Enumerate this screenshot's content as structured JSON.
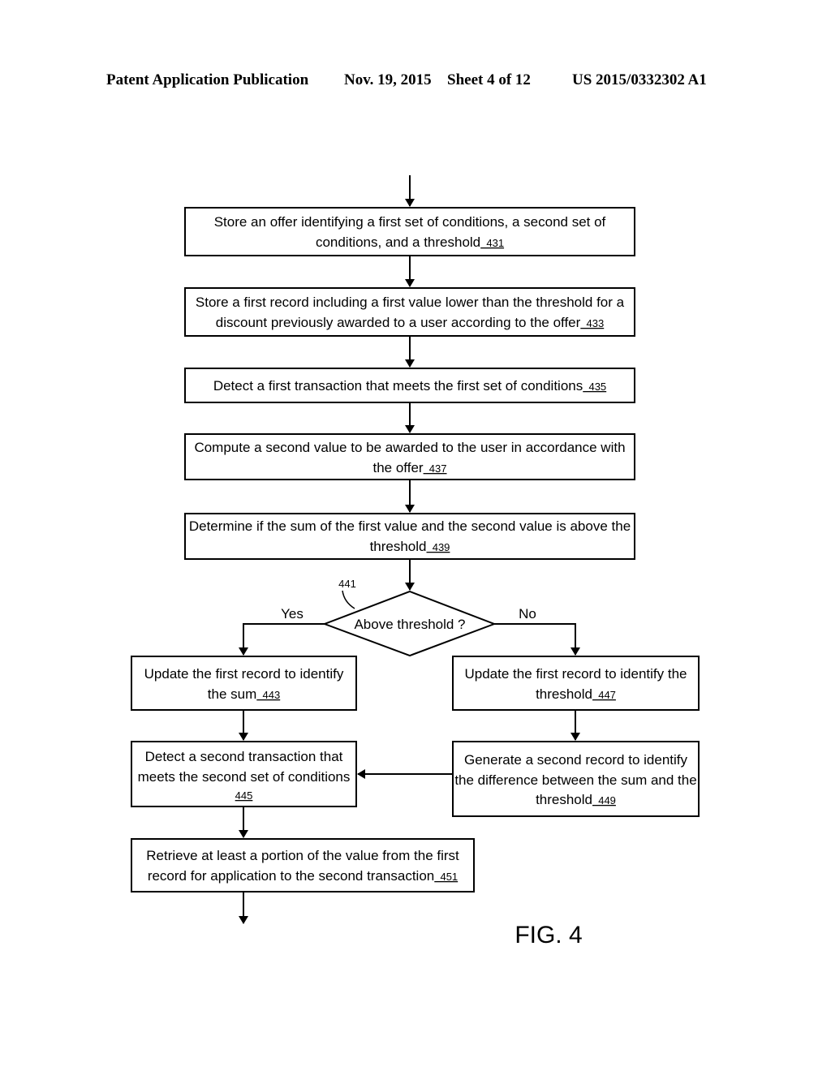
{
  "header": {
    "publication": "Patent Application Publication",
    "date": "Nov. 19, 2015",
    "sheet": "Sheet 4 of 12",
    "number": "US 2015/0332302 A1"
  },
  "figure_label": "FIG. 4",
  "diagram": {
    "steps": [
      {
        "id": "431",
        "lines": [
          "Store an offer identifying a first set of conditions, a second set of",
          "conditions, and a threshold"
        ]
      },
      {
        "id": "433",
        "lines": [
          "Store a first record including a first value lower than the threshold for a",
          "discount previously awarded to a user according to the offer"
        ]
      },
      {
        "id": "435",
        "lines": [
          "Detect a first transaction that meets the first set of conditions"
        ]
      },
      {
        "id": "437",
        "lines": [
          "Compute a second value to be awarded to the user in accordance with",
          "the offer"
        ]
      },
      {
        "id": "439",
        "lines": [
          "Determine if the sum of the first value and the second value is above the",
          "threshold"
        ]
      },
      {
        "id": "443",
        "lines": [
          "Update the first record to identify",
          "the sum"
        ]
      },
      {
        "id": "445",
        "lines": [
          "Detect a second transaction that",
          "meets the second set of conditions",
          ""
        ]
      },
      {
        "id": "447",
        "lines": [
          "Update the first record to identify the",
          "threshold"
        ]
      },
      {
        "id": "449",
        "lines": [
          "Generate a second record to identify",
          "the difference between the sum and the",
          "threshold"
        ]
      },
      {
        "id": "451",
        "lines": [
          "Retrieve at least a portion of the value from the first",
          "record for application to the second transaction"
        ]
      }
    ],
    "decision": {
      "id": "441",
      "text": "Above threshold ?",
      "yes_label": "Yes",
      "no_label": "No"
    }
  }
}
